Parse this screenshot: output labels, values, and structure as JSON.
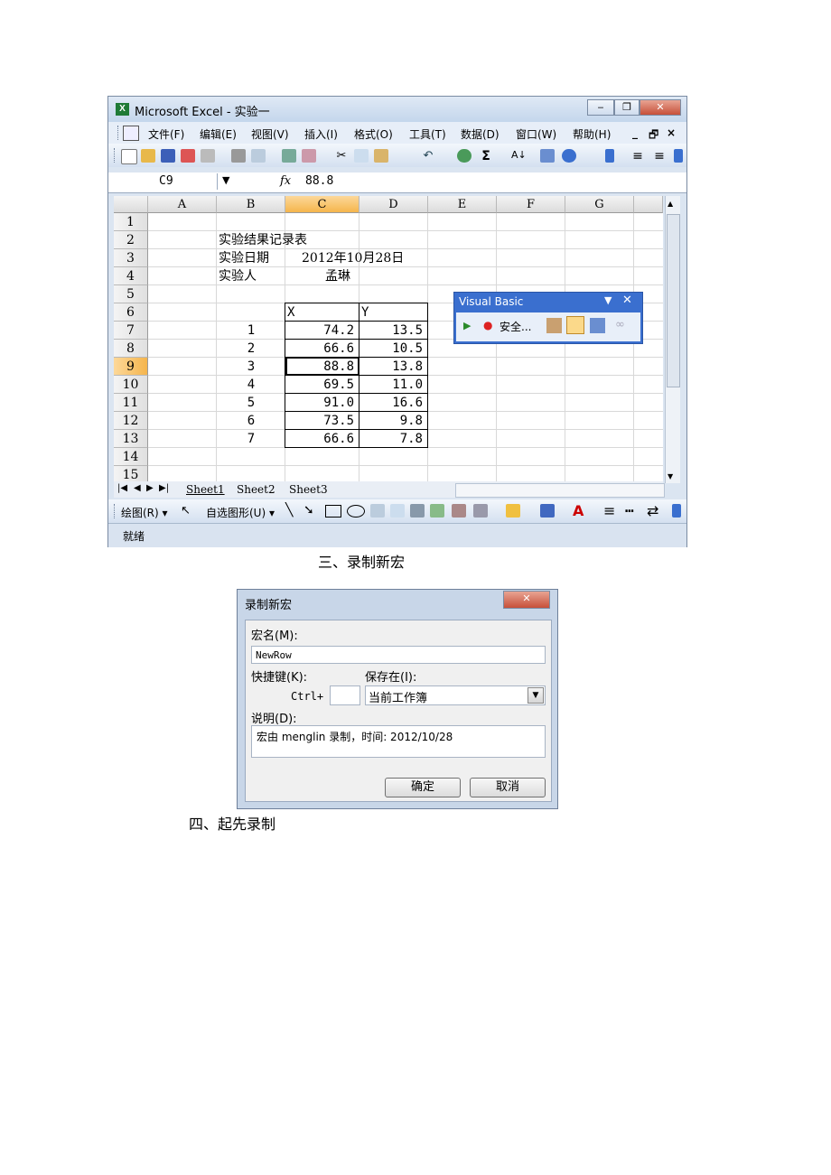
{
  "captions": {
    "step3": "三、录制新宏",
    "step4": "四、起先录制"
  },
  "excel": {
    "title": "Microsoft Excel - 实验一",
    "menus": [
      "文件(F)",
      "编辑(E)",
      "视图(V)",
      "插入(I)",
      "格式(O)",
      "工具(T)",
      "数据(D)",
      "窗口(W)",
      "帮助(H)"
    ],
    "name_box": "C9",
    "fx": "fx",
    "formula_value": "88.8",
    "columns": [
      "A",
      "B",
      "C",
      "D",
      "E",
      "F",
      "G"
    ],
    "rows": [
      "1",
      "2",
      "3",
      "4",
      "5",
      "6",
      "7",
      "8",
      "9",
      "10",
      "11",
      "12",
      "13",
      "14",
      "15"
    ],
    "selected_cell": "C9",
    "sheet": {
      "title": "实验结果记录表",
      "date_label": "实验日期",
      "date_value": "2012年10月28日",
      "person_label": "实验人",
      "person_value": "孟琳",
      "x_header": "X",
      "y_header": "Y",
      "data": [
        {
          "n": "1",
          "x": "74.2",
          "y": "13.5"
        },
        {
          "n": "2",
          "x": "66.6",
          "y": "10.5"
        },
        {
          "n": "3",
          "x": "88.8",
          "y": "13.8"
        },
        {
          "n": "4",
          "x": "69.5",
          "y": "11.0"
        },
        {
          "n": "5",
          "x": "91.0",
          "y": "16.6"
        },
        {
          "n": "6",
          "x": "73.5",
          "y": "9.8"
        },
        {
          "n": "7",
          "x": "66.6",
          "y": "7.8"
        }
      ]
    },
    "sheet_tabs": [
      "Sheet1",
      "Sheet2",
      "Sheet3"
    ],
    "draw_label": "绘图(R)",
    "autoshape_label": "自选图形(U)",
    "status": "就绪",
    "vb_toolbar": {
      "title": "Visual Basic",
      "security": "安全..."
    },
    "colors": {
      "title_bar": "#c4d6ec",
      "selected_header": "#f5b54c",
      "vb_title": "#3a6fcf",
      "excel_green": "#1f7a36"
    }
  },
  "dialog": {
    "title": "录制新宏",
    "macro_name_label": "宏名(M):",
    "macro_name_value": "NewRow",
    "shortcut_label": "快捷键(K):",
    "ctrl_label": "Ctrl+",
    "shortcut_value": "",
    "store_label": "保存在(I):",
    "store_value": "当前工作簿",
    "desc_label": "说明(D):",
    "desc_value": "宏由 menglin 录制，时间: 2012/10/28",
    "ok_label": "确定",
    "cancel_label": "取消"
  }
}
